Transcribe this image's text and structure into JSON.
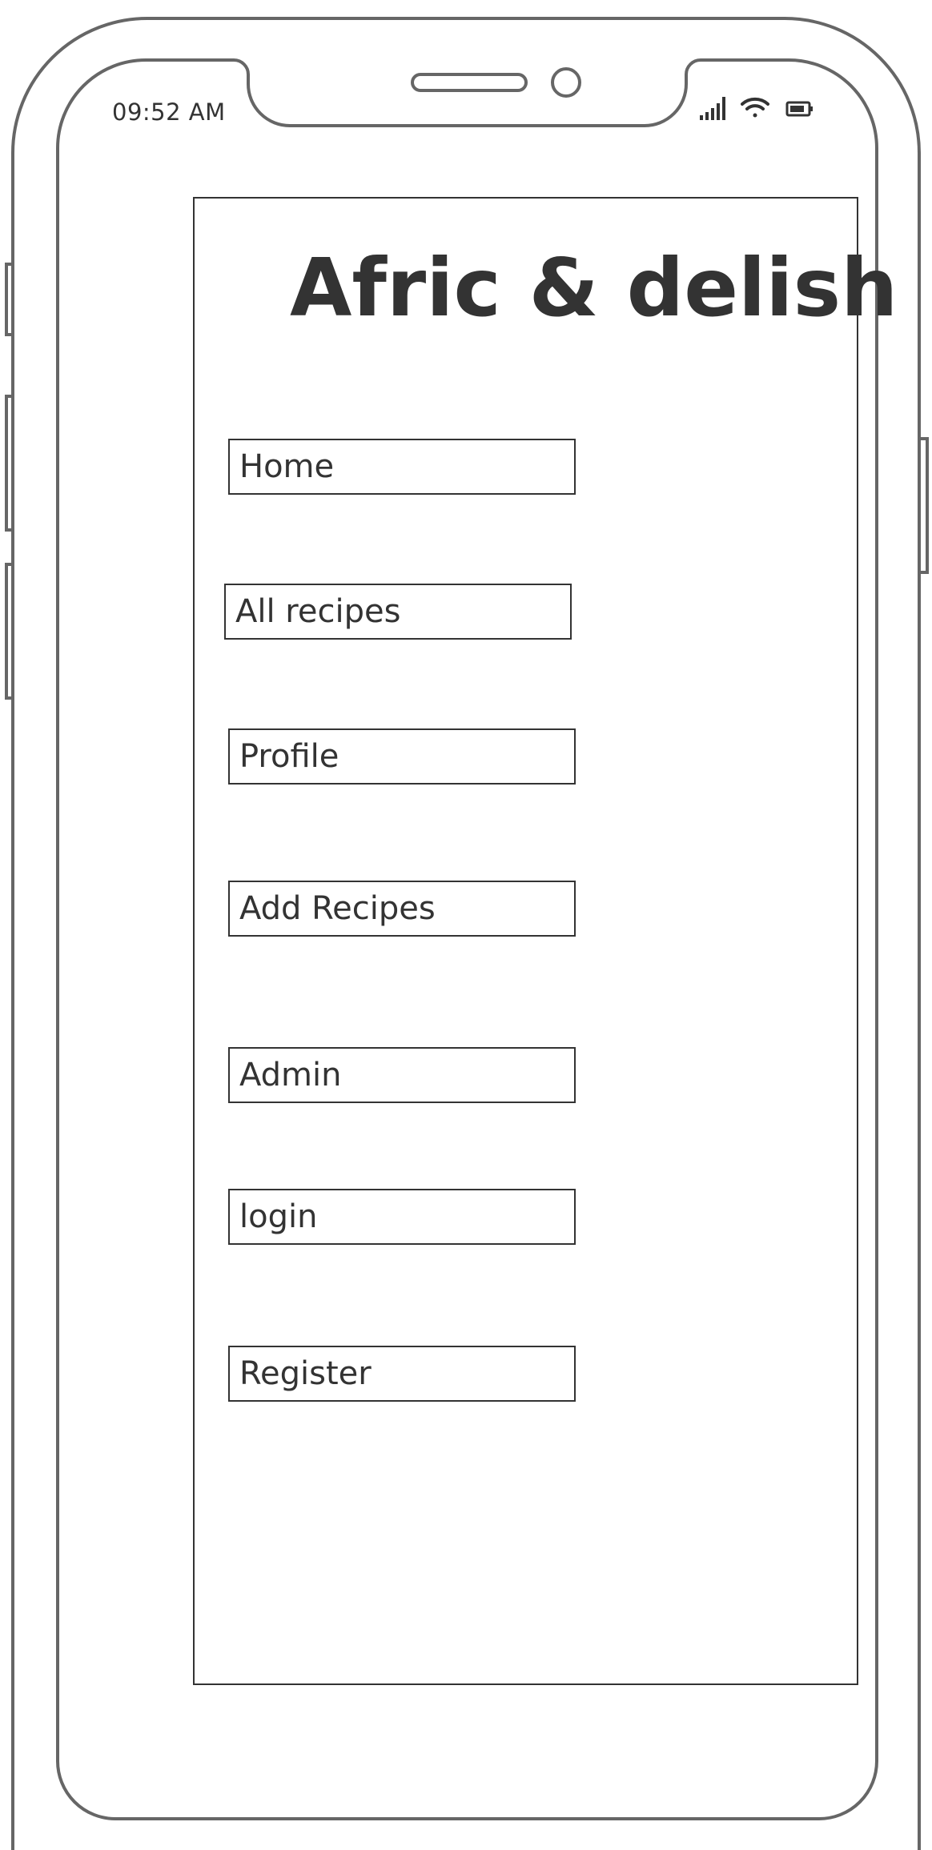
{
  "status_bar": {
    "time": "09:52 AM",
    "icons": [
      "signal-icon",
      "wifi-icon",
      "battery-icon"
    ]
  },
  "app": {
    "title": "Afric & delish"
  },
  "menu": {
    "items": [
      {
        "label": "Home"
      },
      {
        "label": "All recipes"
      },
      {
        "label": "Profile"
      },
      {
        "label": "Add Recipes"
      },
      {
        "label": "Admin"
      },
      {
        "label": "login"
      },
      {
        "label": "Register"
      }
    ]
  },
  "colors": {
    "stroke": "#333333",
    "frame": "#666666",
    "background": "#ffffff"
  }
}
